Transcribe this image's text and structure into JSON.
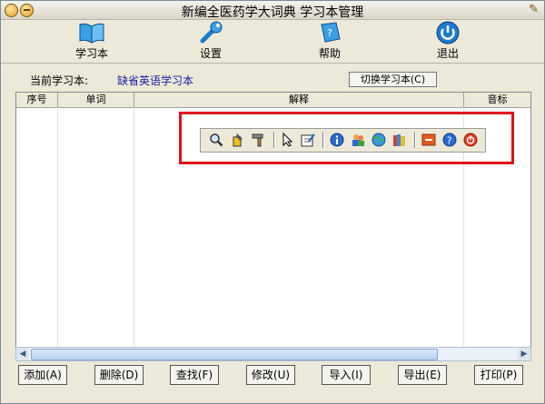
{
  "window": {
    "title": "新编全医药学大词典 学习本管理"
  },
  "toolbar": [
    {
      "label": "学习本",
      "icon": "book-icon"
    },
    {
      "label": "设置",
      "icon": "wrench-icon"
    },
    {
      "label": "帮助",
      "icon": "help-book-icon"
    },
    {
      "label": "退出",
      "icon": "power-icon"
    }
  ],
  "current": {
    "label": "当前学习本:",
    "value": "缺省英语学习本",
    "switch_label": "切换学习本(C)"
  },
  "grid": {
    "columns": [
      "序号",
      "单词",
      "解释",
      "音标"
    ]
  },
  "buttons": [
    {
      "label": "添加(A)"
    },
    {
      "label": "删除(D)"
    },
    {
      "label": "查找(F)"
    },
    {
      "label": "修改(U)"
    },
    {
      "label": "导入(I)"
    },
    {
      "label": "导出(E)"
    },
    {
      "label": "打印(P)"
    }
  ],
  "floating_toolbar": {
    "icons": [
      "magnifier-icon",
      "pen-icon",
      "hammer-icon",
      "cursor-icon",
      "note-edit-icon",
      "info-icon",
      "users-icon",
      "globe-icon",
      "books-icon",
      "minus-icon",
      "help-icon",
      "power-icon"
    ]
  },
  "colors": {
    "highlight_box": "#e0101a",
    "accent_blue": "#1a1aa0"
  }
}
